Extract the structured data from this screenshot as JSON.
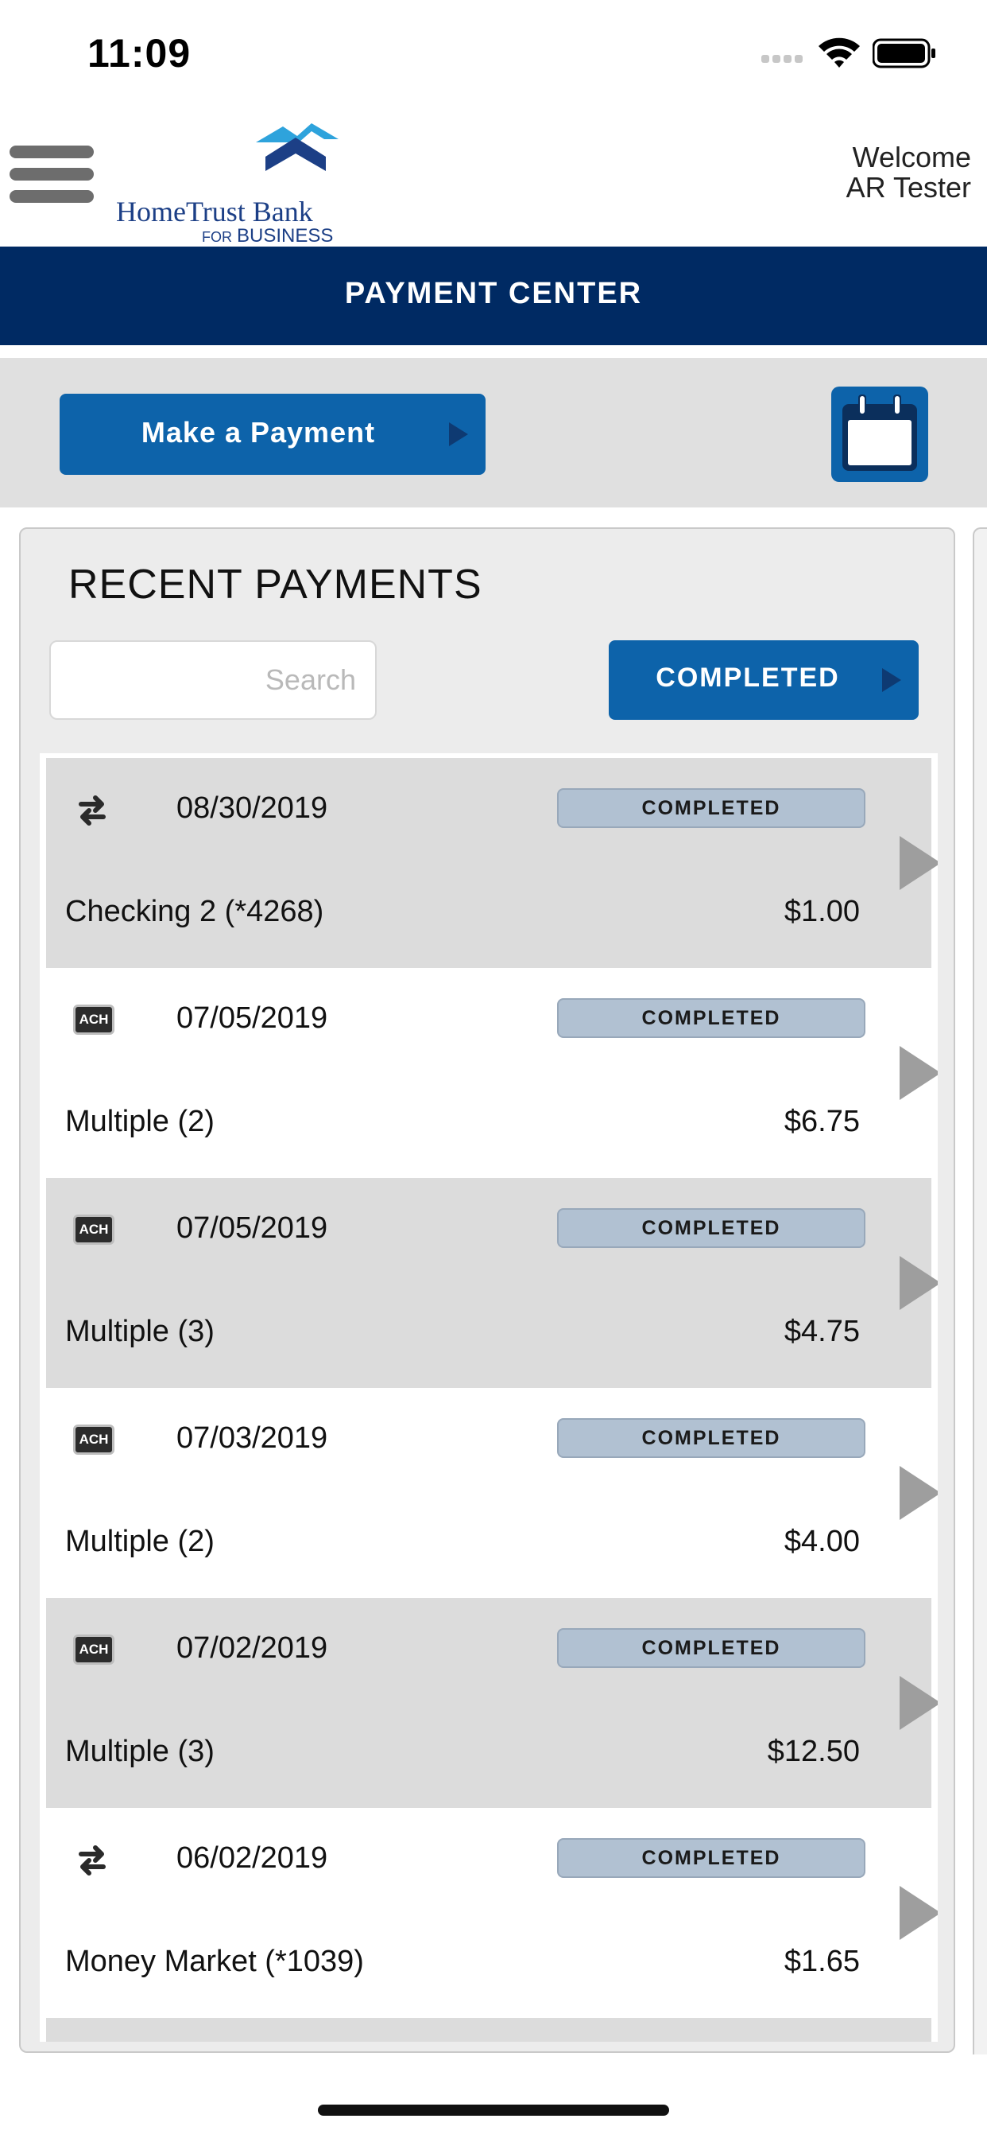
{
  "status_bar": {
    "time": "11:09"
  },
  "header": {
    "logo_name": "HomeTrust Bank",
    "logo_sub_for": "FOR",
    "logo_sub": "BUSINESS",
    "welcome": "Welcome",
    "user_name": "AR Tester"
  },
  "title": "PAYMENT CENTER",
  "actions": {
    "make_payment_label": "Make a Payment"
  },
  "recent": {
    "title": "RECENT PAYMENTS",
    "search_placeholder": "Search",
    "filter_label": "COMPLETED"
  },
  "payments": [
    {
      "type": "transfer-icon",
      "date": "08/30/2019",
      "status": "COMPLETED",
      "account": "Checking 2 (*4268)",
      "amount": "$1.00"
    },
    {
      "type": "ACH",
      "date": "07/05/2019",
      "status": "COMPLETED",
      "account": "Multiple (2)",
      "amount": "$6.75"
    },
    {
      "type": "ACH",
      "date": "07/05/2019",
      "status": "COMPLETED",
      "account": "Multiple (3)",
      "amount": "$4.75"
    },
    {
      "type": "ACH",
      "date": "07/03/2019",
      "status": "COMPLETED",
      "account": "Multiple (2)",
      "amount": "$4.00"
    },
    {
      "type": "ACH",
      "date": "07/02/2019",
      "status": "COMPLETED",
      "account": "Multiple (3)",
      "amount": "$12.50"
    },
    {
      "type": "transfer-icon",
      "date": "06/02/2019",
      "status": "COMPLETED",
      "account": "Money Market (*1039)",
      "amount": "$1.65"
    }
  ],
  "colors": {
    "navy": "#002a63",
    "button_blue": "#0d63aa",
    "status_pill": "#b1c1d2",
    "row_alt": "#dcdcdc"
  }
}
